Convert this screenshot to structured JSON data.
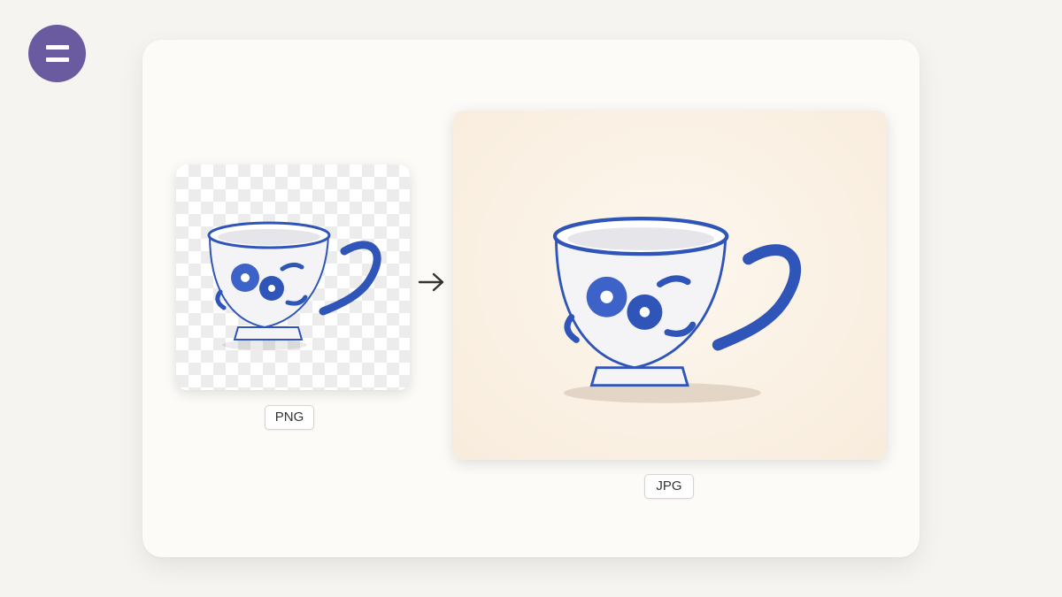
{
  "app": {
    "logo_icon": "equals-icon",
    "accent_color": "#6a5aa0"
  },
  "conversion": {
    "source": {
      "format_label": "PNG",
      "image_subject": "blue-floral-teacup",
      "background": "transparent-checkerboard"
    },
    "target": {
      "format_label": "JPG",
      "image_subject": "blue-floral-teacup",
      "background": "cream-paper"
    },
    "arrow_icon": "arrow-right-icon"
  },
  "colors": {
    "porcelain_blue": "#2f55b8",
    "card_bg": "#fcfbf8",
    "jpg_bg": "#f8ecdc"
  }
}
